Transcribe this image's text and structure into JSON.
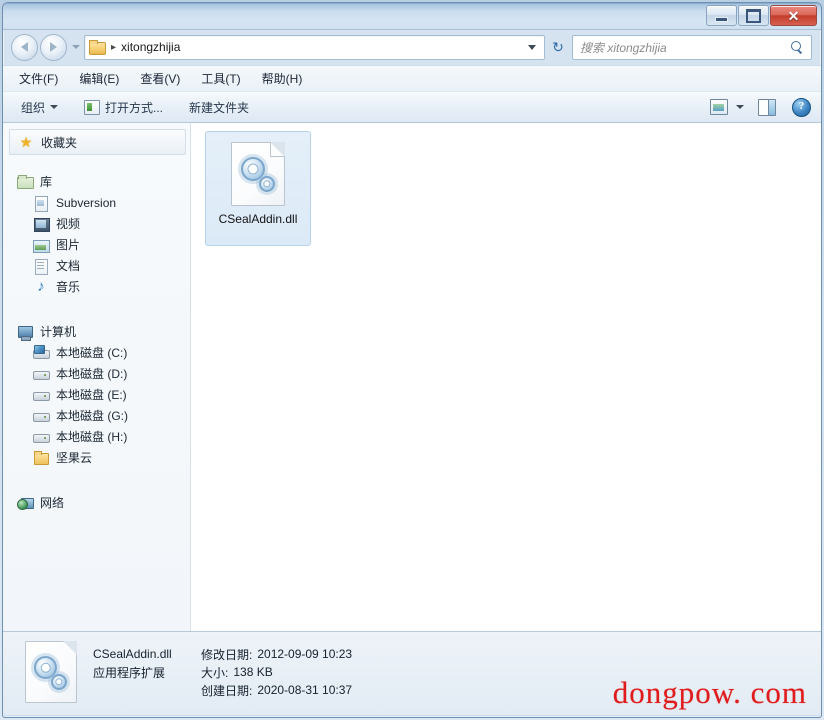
{
  "window": {
    "controls": {
      "minimize": "–",
      "maximize": "□",
      "close": "✕"
    }
  },
  "navigation": {
    "back_icon": "back-arrow",
    "forward_icon": "forward-arrow",
    "history_icon": "history-dropdown",
    "breadcrumb": {
      "folder_icon": "folder-icon",
      "separator": "▸",
      "path": "xitongzhijia"
    },
    "address_dropdown_icon": "chevron-down-icon",
    "refresh_icon": "↻"
  },
  "search": {
    "placeholder": "搜索 xitongzhijia",
    "icon": "search-icon"
  },
  "menubar": {
    "items": [
      {
        "label": "文件(F)"
      },
      {
        "label": "编辑(E)"
      },
      {
        "label": "查看(V)"
      },
      {
        "label": "工具(T)"
      },
      {
        "label": "帮助(H)"
      }
    ]
  },
  "toolbar": {
    "organize": "组织",
    "open_with": "打开方式...",
    "new_folder": "新建文件夹",
    "view_icon": "change-view-icon",
    "pane_icon": "preview-pane-icon",
    "help_icon": "?"
  },
  "sidebar": {
    "favorites": {
      "label": "收藏夹",
      "icon": "star-icon"
    },
    "libraries": {
      "label": "库",
      "icon": "library-icon",
      "items": [
        {
          "label": "Subversion",
          "icon": "subversion-icon"
        },
        {
          "label": "视频",
          "icon": "video-icon"
        },
        {
          "label": "图片",
          "icon": "pictures-icon"
        },
        {
          "label": "文档",
          "icon": "documents-icon"
        },
        {
          "label": "音乐",
          "icon": "music-icon"
        }
      ]
    },
    "computer": {
      "label": "计算机",
      "icon": "computer-icon",
      "items": [
        {
          "label": "本地磁盘 (C:)",
          "icon": "system-drive-icon"
        },
        {
          "label": "本地磁盘 (D:)",
          "icon": "drive-icon"
        },
        {
          "label": "本地磁盘 (E:)",
          "icon": "drive-icon"
        },
        {
          "label": "本地磁盘 (G:)",
          "icon": "drive-icon"
        },
        {
          "label": "本地磁盘 (H:)",
          "icon": "drive-icon"
        },
        {
          "label": "坚果云",
          "icon": "folder-icon"
        }
      ]
    },
    "network": {
      "label": "网络",
      "icon": "network-icon"
    }
  },
  "files": [
    {
      "name": "CSealAddin.dll",
      "icon": "dll-icon",
      "selected": true
    }
  ],
  "status": {
    "icon": "dll-icon",
    "name": "CSealAddin.dll",
    "type": "应用程序扩展",
    "modified_label": "修改日期:",
    "modified_value": "2012-09-09 10:23",
    "size_label": "大小:",
    "size_value": "138 KB",
    "created_label": "创建日期:",
    "created_value": "2020-08-31 10:37"
  },
  "watermark": {
    "text": "dongpow. com",
    "color": "#e01b1b"
  }
}
